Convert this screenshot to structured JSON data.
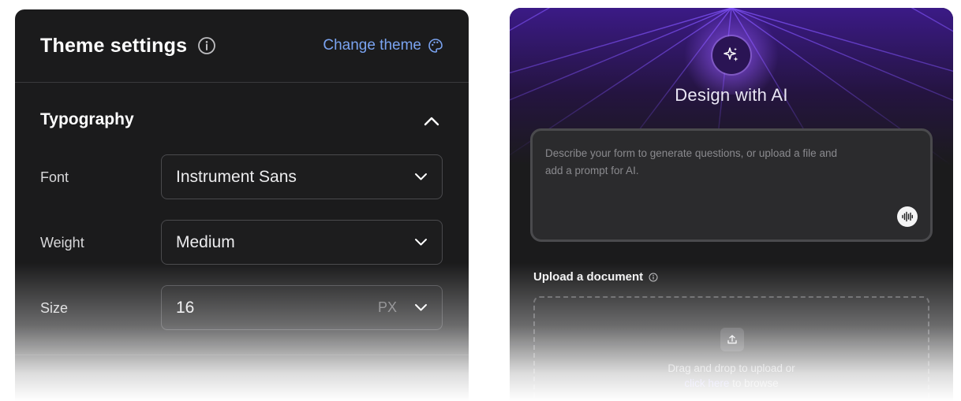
{
  "theme_settings": {
    "title": "Theme settings",
    "change_theme_label": "Change theme",
    "section_title": "Typography",
    "rows": [
      {
        "label": "Font",
        "value": "Instrument Sans"
      },
      {
        "label": "Weight",
        "value": "Medium"
      },
      {
        "label": "Size",
        "value": "16",
        "unit": "PX"
      }
    ],
    "accent_color": "#7aa3f0"
  },
  "ai_panel": {
    "title": "Design with AI",
    "prompt_placeholder": "Describe your form to generate questions, or upload a file and add a prompt for AI.",
    "upload_title": "Upload a document",
    "drop_text": "Drag and drop to upload or",
    "browse_link": "click here",
    "browse_suffix": "to browse",
    "accent_color": "#7b6ef0"
  }
}
